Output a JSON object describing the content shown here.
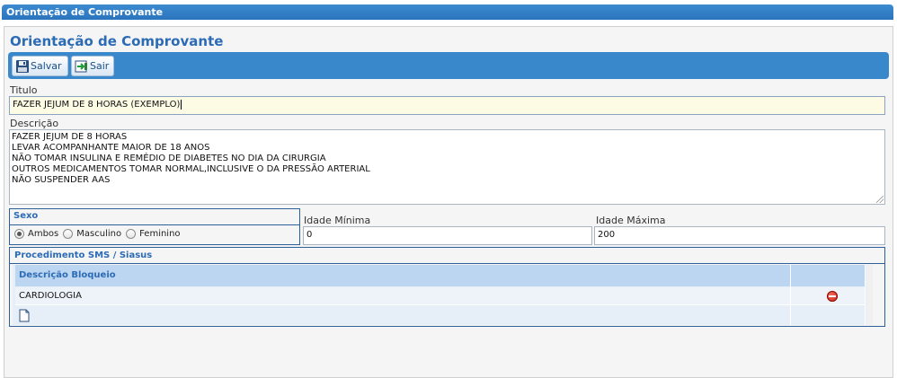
{
  "window": {
    "title": "Orientação de Comprovante"
  },
  "page": {
    "title": "Orientação de Comprovante"
  },
  "toolbar": {
    "save_label": "Salvar",
    "exit_label": "Sair"
  },
  "form": {
    "titulo_label": "Titulo",
    "titulo_value": "FAZER JEJUM DE 8 HORAS (EXEMPLO)",
    "descricao_label": "Descrição",
    "descricao_lines": [
      "FAZER JEJUM DE 8 HORAS",
      "LEVAR ACOMPANHANTE MAIOR DE 18 ANOS",
      "NÃO TOMAR INSULINA E REMÉDIO DE DIABETES NO DIA DA CIRURGIA",
      "OUTROS MEDICAMENTOS TOMAR NORMAL,INCLUSIVE O DA PRESSÃO ARTERIAL",
      "NÃO SUSPENDER AAS"
    ],
    "sexo": {
      "legend": "Sexo",
      "options": [
        "Ambos",
        "Masculino",
        "Feminino"
      ],
      "selected": "Ambos"
    },
    "idade_minima_label": "Idade Mínima",
    "idade_minima_value": "0",
    "idade_maxima_label": "Idade Máxima",
    "idade_maxima_value": "200"
  },
  "procedimento": {
    "legend": "Procedimento SMS / Siasus",
    "columns": [
      "Descrição Bloqueio"
    ],
    "rows": [
      {
        "descricao": "CARDIOLOGIA"
      }
    ]
  },
  "icons": {
    "save": "floppy-disk-icon",
    "exit": "exit-arrow-icon",
    "remove": "remove-circle-icon",
    "new": "new-document-icon"
  },
  "colors": {
    "accent": "#3a88cc",
    "title": "#2c6bb5",
    "remove": "#d0281a"
  }
}
